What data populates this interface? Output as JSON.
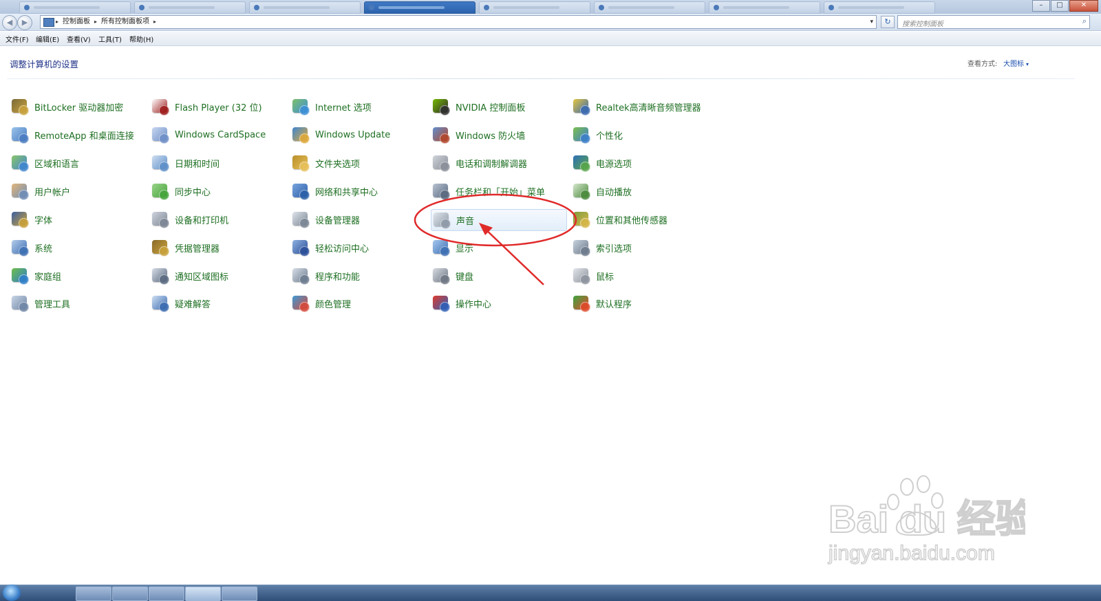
{
  "window": {
    "controls": {
      "minimize": "–",
      "maximize": "□",
      "close": "✕"
    }
  },
  "addressbar": {
    "back_icon": "back-arrow-icon",
    "forward_icon": "forward-arrow-icon",
    "breadcrumbs": [
      "控制面板",
      "所有控制面板项"
    ],
    "separator": "▸",
    "dropdown": "▾",
    "refresh": "↻",
    "search_placeholder": "搜索控制面板",
    "search_icon": "⌕"
  },
  "menubar": [
    "文件(F)",
    "编辑(E)",
    "查看(V)",
    "工具(T)",
    "帮助(H)"
  ],
  "header": {
    "title": "调整计算机的设置",
    "view_label": "查看方式:",
    "view_value": "大图标",
    "view_caret": "▾"
  },
  "items": [
    {
      "label": "BitLocker 驱动器加密",
      "icon": "bitlocker-icon"
    },
    {
      "label": "Flash Player (32 位)",
      "icon": "flash-icon"
    },
    {
      "label": "Internet 选项",
      "icon": "internet-options-icon"
    },
    {
      "label": "NVIDIA 控制面板",
      "icon": "nvidia-icon"
    },
    {
      "label": "Realtek高清晰音频管理器",
      "icon": "realtek-icon"
    },
    {
      "label": "RemoteApp 和桌面连接",
      "icon": "remoteapp-icon"
    },
    {
      "label": "Windows CardSpace",
      "icon": "cardspace-icon"
    },
    {
      "label": "Windows Update",
      "icon": "windows-update-icon"
    },
    {
      "label": "Windows 防火墙",
      "icon": "firewall-icon"
    },
    {
      "label": "个性化",
      "icon": "personalization-icon"
    },
    {
      "label": "区域和语言",
      "icon": "region-language-icon"
    },
    {
      "label": "日期和时间",
      "icon": "date-time-icon"
    },
    {
      "label": "文件夹选项",
      "icon": "folder-options-icon"
    },
    {
      "label": "电话和调制解调器",
      "icon": "phone-modem-icon"
    },
    {
      "label": "电源选项",
      "icon": "power-options-icon"
    },
    {
      "label": "用户帐户",
      "icon": "user-accounts-icon"
    },
    {
      "label": "同步中心",
      "icon": "sync-center-icon"
    },
    {
      "label": "网络和共享中心",
      "icon": "network-sharing-icon"
    },
    {
      "label": "任务栏和「开始」菜单",
      "icon": "taskbar-start-icon"
    },
    {
      "label": "自动播放",
      "icon": "autoplay-icon"
    },
    {
      "label": "字体",
      "icon": "fonts-icon"
    },
    {
      "label": "设备和打印机",
      "icon": "devices-printers-icon"
    },
    {
      "label": "设备管理器",
      "icon": "device-manager-icon"
    },
    {
      "label": "声音",
      "icon": "sound-icon"
    },
    {
      "label": "位置和其他传感器",
      "icon": "location-sensors-icon"
    },
    {
      "label": "系统",
      "icon": "system-icon"
    },
    {
      "label": "凭据管理器",
      "icon": "credential-manager-icon"
    },
    {
      "label": "轻松访问中心",
      "icon": "ease-of-access-icon"
    },
    {
      "label": "显示",
      "icon": "display-icon"
    },
    {
      "label": "索引选项",
      "icon": "indexing-options-icon"
    },
    {
      "label": "家庭组",
      "icon": "homegroup-icon"
    },
    {
      "label": "通知区域图标",
      "icon": "notification-area-icon"
    },
    {
      "label": "程序和功能",
      "icon": "programs-features-icon"
    },
    {
      "label": "键盘",
      "icon": "keyboard-icon"
    },
    {
      "label": "鼠标",
      "icon": "mouse-icon"
    },
    {
      "label": "管理工具",
      "icon": "admin-tools-icon"
    },
    {
      "label": "疑难解答",
      "icon": "troubleshooting-icon"
    },
    {
      "label": "颜色管理",
      "icon": "color-management-icon"
    },
    {
      "label": "操作中心",
      "icon": "action-center-icon"
    },
    {
      "label": "默认程序",
      "icon": "default-programs-icon"
    }
  ],
  "highlighted_item": "声音",
  "annotation": {
    "color": "#e02a2a"
  },
  "watermark": {
    "brand": "Bai du 经验",
    "url": "jingyan.baidu.com"
  },
  "colors": {
    "item_text": "#1e6f22",
    "title_text": "#1e3287",
    "link_text": "#1b4fb0"
  }
}
